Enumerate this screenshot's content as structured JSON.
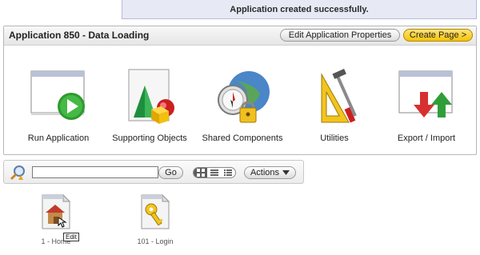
{
  "notification": {
    "message": "Application created successfully."
  },
  "panel": {
    "title": "Application 850 - Data Loading",
    "edit_label": "Edit Application Properties",
    "create_label": "Create Page >"
  },
  "tiles": [
    {
      "label": "Run Application",
      "icon": "run-application-icon"
    },
    {
      "label": "Supporting Objects",
      "icon": "supporting-objects-icon"
    },
    {
      "label": "Shared Components",
      "icon": "shared-components-icon"
    },
    {
      "label": "Utilities",
      "icon": "utilities-icon"
    },
    {
      "label": "Export / Import",
      "icon": "export-import-icon"
    }
  ],
  "toolbar": {
    "search_value": "",
    "go_label": "Go",
    "actions_label": "Actions"
  },
  "pages": [
    {
      "label": "1 - Home",
      "icon": "home-page-icon"
    },
    {
      "label": "101 - Login",
      "icon": "login-page-icon"
    }
  ],
  "tooltip": {
    "text": "Edit"
  },
  "colors": {
    "accent_gold": "#f5c400",
    "notification_bg": "#e7e9f5"
  }
}
